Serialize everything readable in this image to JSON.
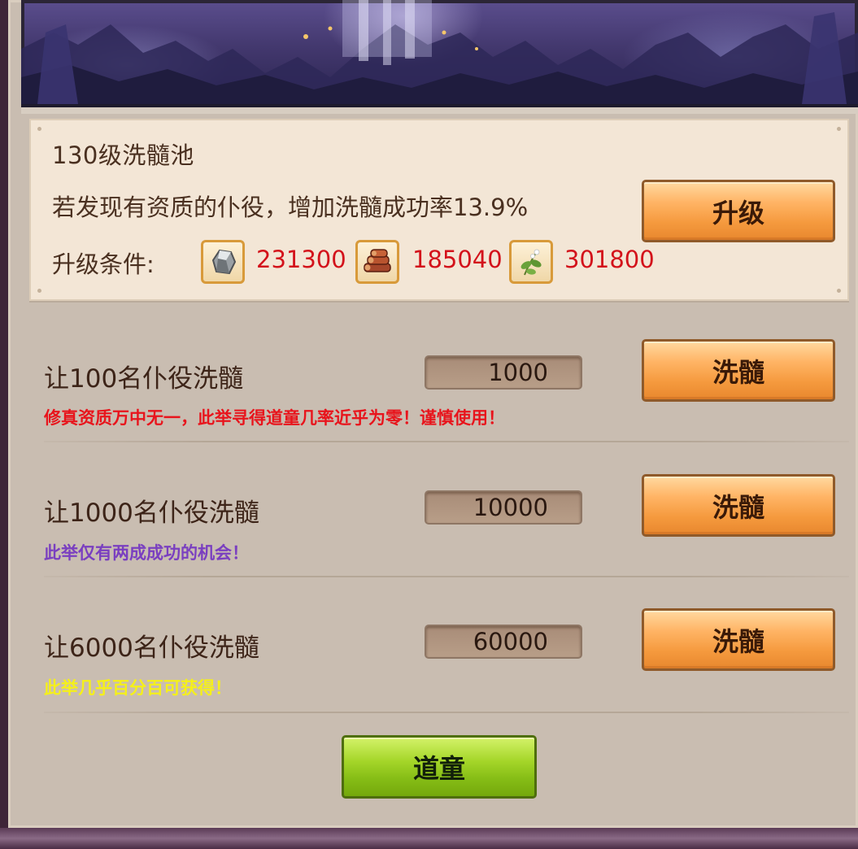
{
  "upgrade": {
    "title": "130级洗髓池",
    "description": "若发现有资质的仆役，增加洗髓成功率13.9%",
    "condition_label": "升级条件:",
    "button_label": "升级",
    "resources": [
      {
        "icon": "stone-ore-icon",
        "value": "231300"
      },
      {
        "icon": "wood-logs-icon",
        "value": "185040"
      },
      {
        "icon": "herb-plant-icon",
        "value": "301800"
      }
    ]
  },
  "options": [
    {
      "title": "让100名仆役洗髓",
      "cost": "1000",
      "button_label": "洗髓",
      "note": "修真资质万中无一，此举寻得道童几率近乎为零！谨慎使用！",
      "note_color": "#e8141c"
    },
    {
      "title": "让1000名仆役洗髓",
      "cost": "10000",
      "button_label": "洗髓",
      "note": "此举仅有两成成功的机会！",
      "note_color": "#7a3fc0"
    },
    {
      "title": "让6000名仆役洗髓",
      "cost": "60000",
      "button_label": "洗髓",
      "note": "此举几乎百分百可获得！",
      "note_color": "#f5f01a"
    }
  ],
  "footer": {
    "button_label": "道童"
  }
}
